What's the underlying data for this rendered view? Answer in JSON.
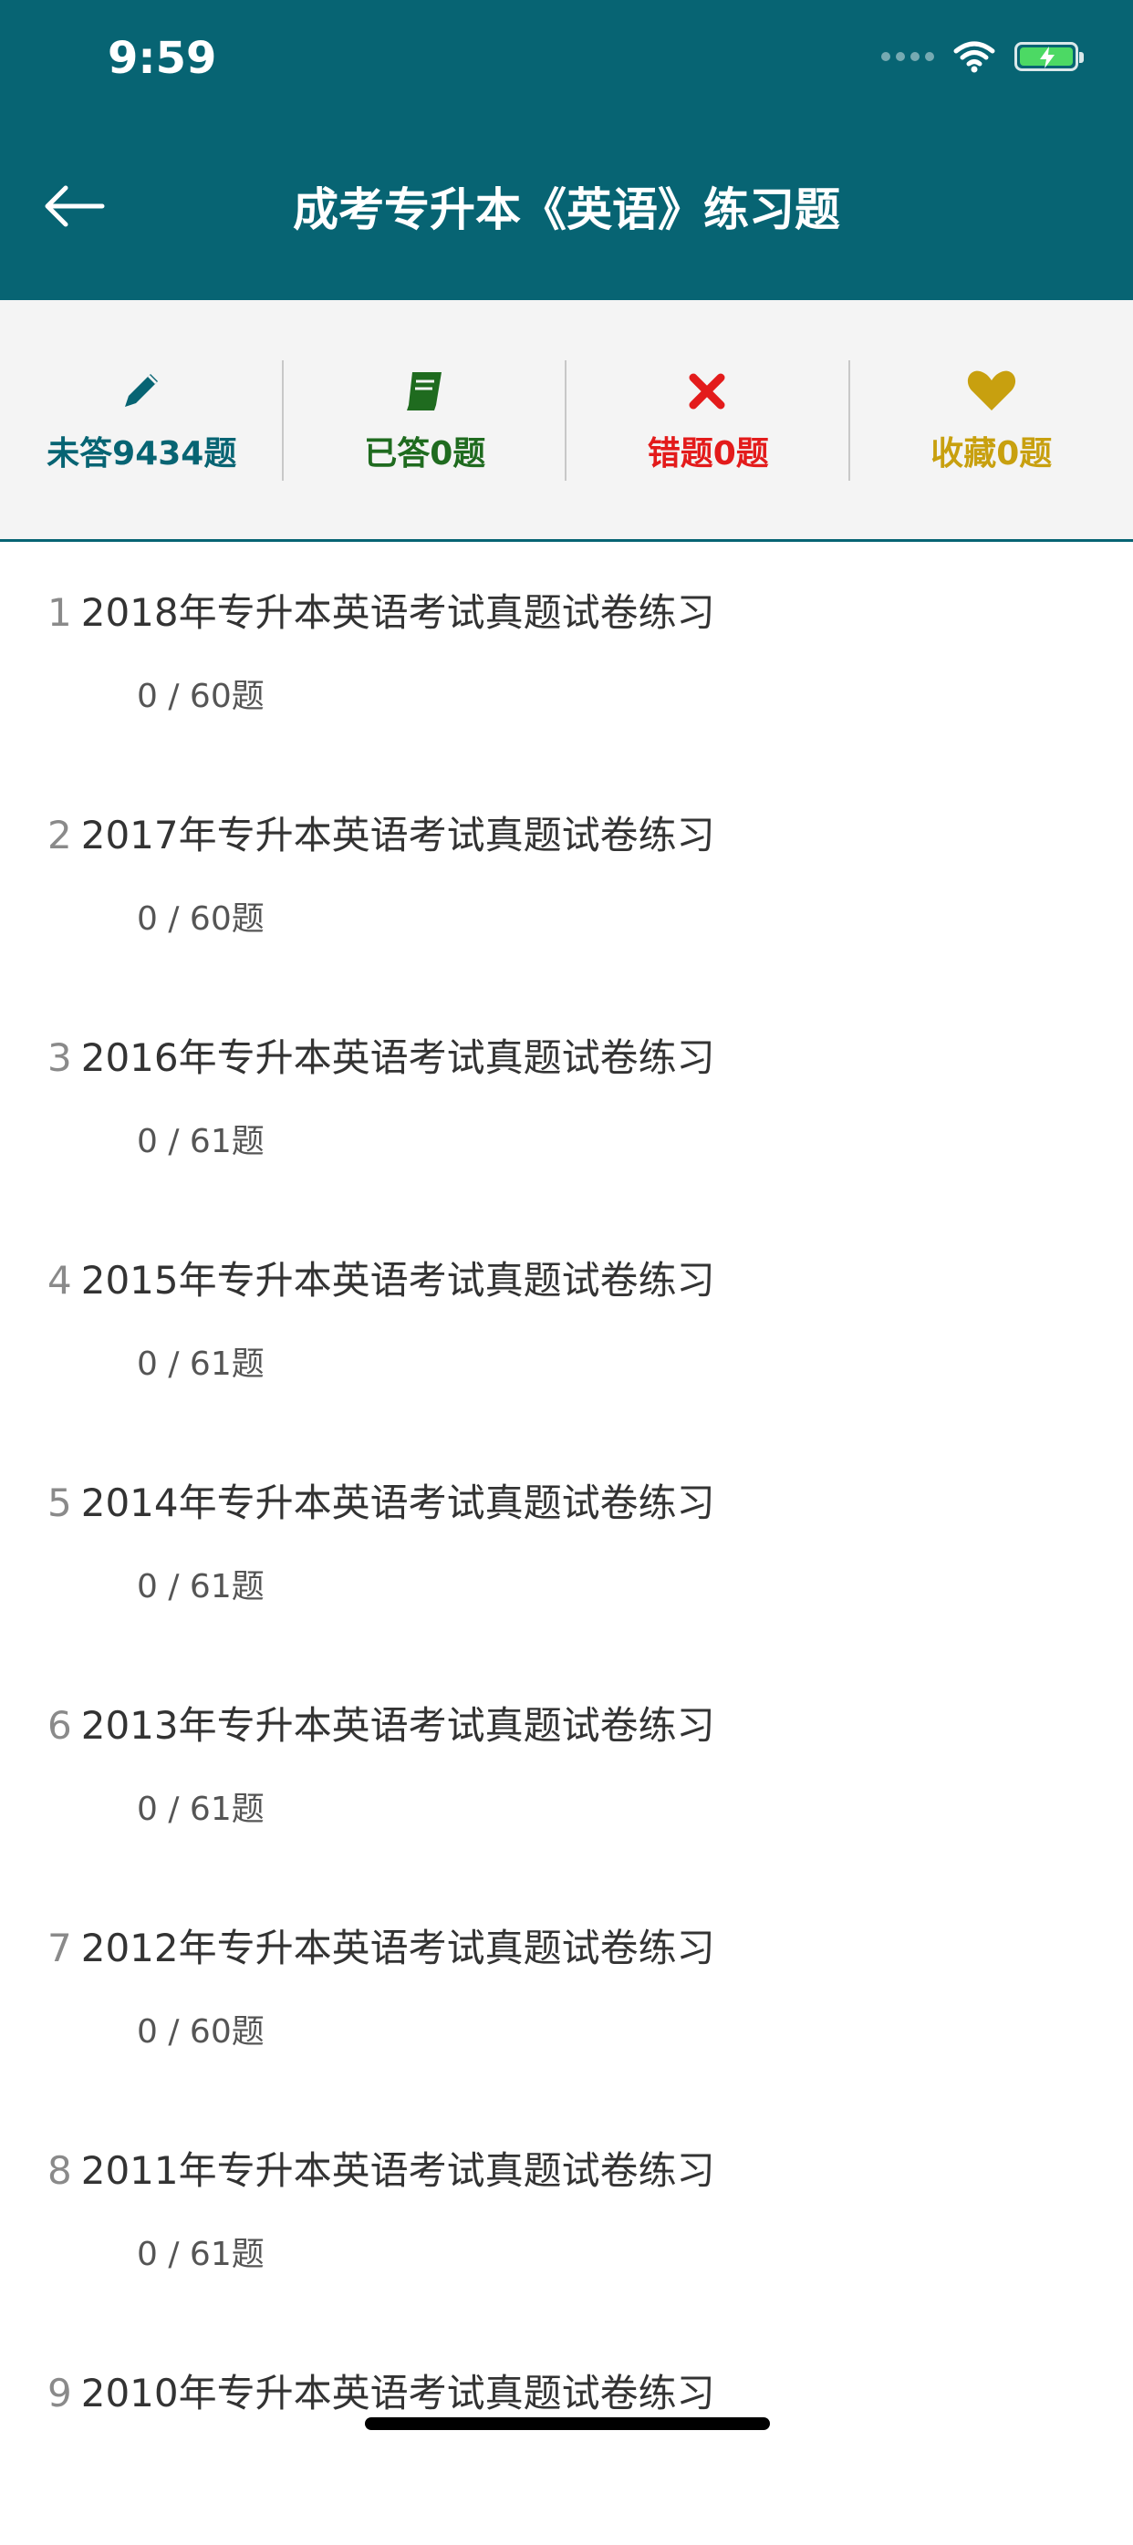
{
  "status_bar": {
    "time": "9:59"
  },
  "header": {
    "title": "成考专升本《英语》练习题"
  },
  "stats": [
    {
      "label": "未答9434题",
      "color": "#076473",
      "icon": "pencil-icon"
    },
    {
      "label": "已答0题",
      "color": "#1f6b1f",
      "icon": "book-icon"
    },
    {
      "label": "错题0题",
      "color": "#e31b1b",
      "icon": "close-x-icon"
    },
    {
      "label": "收藏0题",
      "color": "#c8a00f",
      "icon": "heart-icon"
    }
  ],
  "items": [
    {
      "num": "1",
      "title": "2018年专升本英语考试真题试卷练习",
      "progress": "0 / 60题"
    },
    {
      "num": "2",
      "title": "2017年专升本英语考试真题试卷练习",
      "progress": "0 / 60题"
    },
    {
      "num": "3",
      "title": "2016年专升本英语考试真题试卷练习",
      "progress": "0 / 61题"
    },
    {
      "num": "4",
      "title": "2015年专升本英语考试真题试卷练习",
      "progress": "0 / 61题"
    },
    {
      "num": "5",
      "title": "2014年专升本英语考试真题试卷练习",
      "progress": "0 / 61题"
    },
    {
      "num": "6",
      "title": "2013年专升本英语考试真题试卷练习",
      "progress": "0 / 61题"
    },
    {
      "num": "7",
      "title": "2012年专升本英语考试真题试卷练习",
      "progress": "0 / 60题"
    },
    {
      "num": "8",
      "title": "2011年专升本英语考试真题试卷练习",
      "progress": "0 / 61题"
    },
    {
      "num": "9",
      "title": "2010年专升本英语考试真题试卷练习",
      "progress": ""
    }
  ],
  "colors": {
    "header_bg": "#076473",
    "stats_bg": "#f4f4f4"
  }
}
